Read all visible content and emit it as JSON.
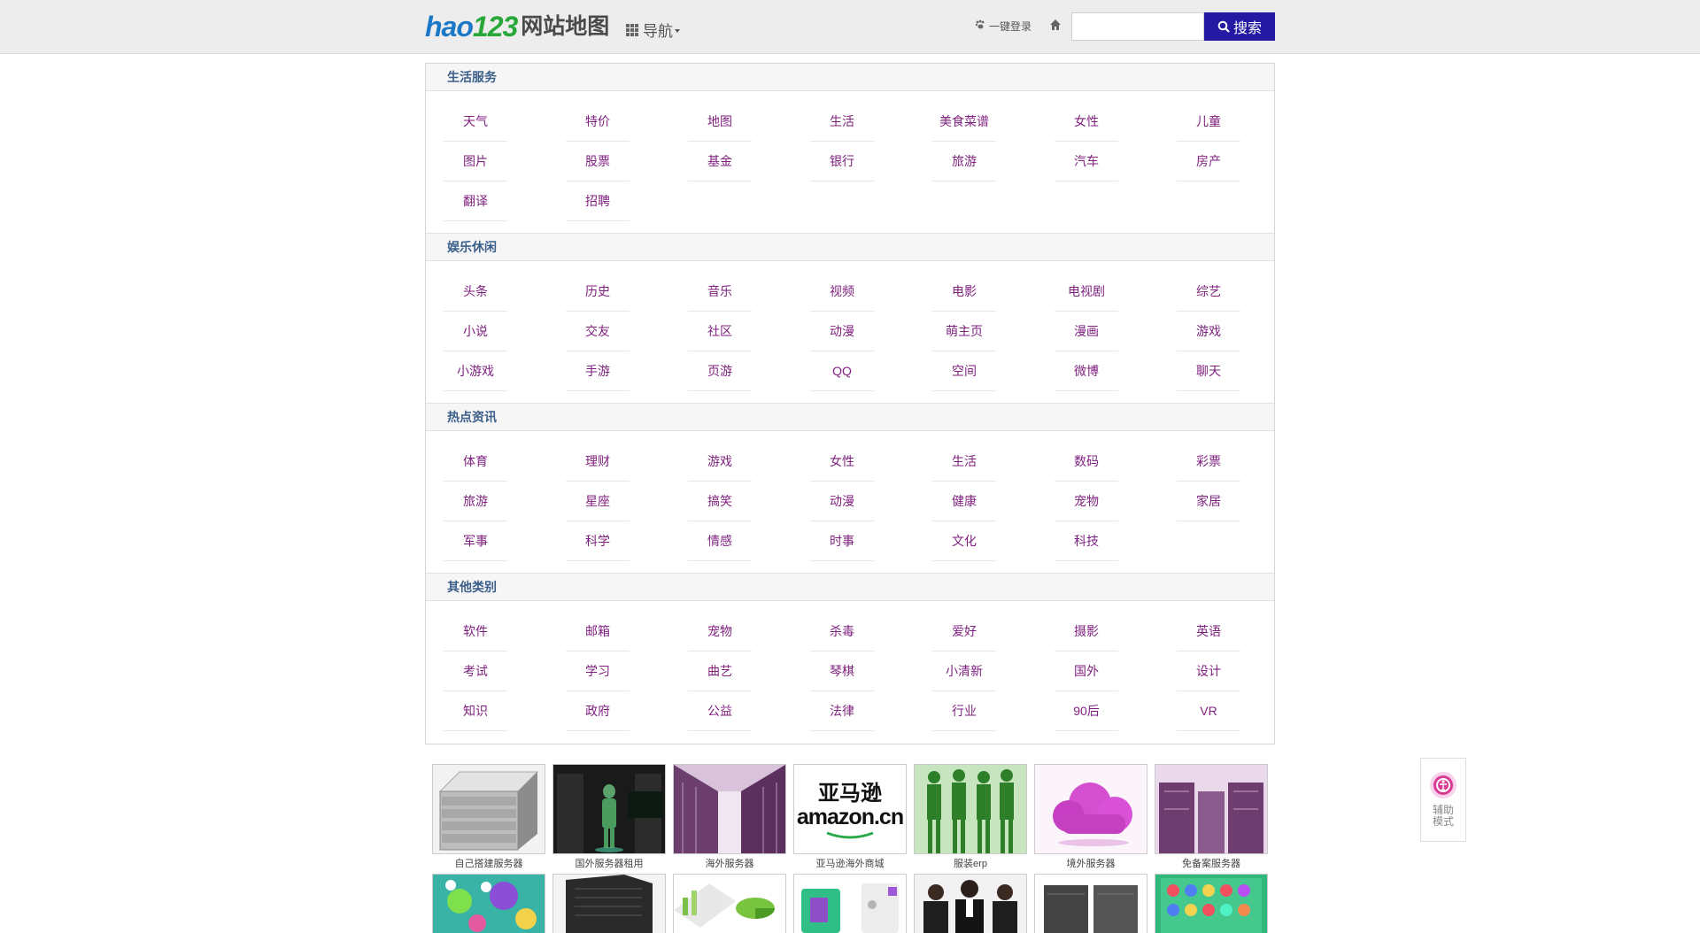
{
  "header": {
    "logo_hao": "hao",
    "logo_123": "123",
    "site_title": "网站地图",
    "nav_label": "导航",
    "login_label": "一键登录",
    "search_placeholder": "",
    "search_button": "搜索"
  },
  "sections": [
    {
      "title": "生活服务",
      "links": [
        "天气",
        "特价",
        "地图",
        "生活",
        "美食菜谱",
        "女性",
        "儿童",
        "图片",
        "股票",
        "基金",
        "银行",
        "旅游",
        "汽车",
        "房产",
        "翻译",
        "招聘"
      ]
    },
    {
      "title": "娱乐休闲",
      "links": [
        "头条",
        "历史",
        "音乐",
        "视频",
        "电影",
        "电视剧",
        "综艺",
        "小说",
        "交友",
        "社区",
        "动漫",
        "萌主页",
        "漫画",
        "游戏",
        "小游戏",
        "手游",
        "页游",
        "QQ",
        "空间",
        "微博",
        "聊天"
      ]
    },
    {
      "title": "热点资讯",
      "links": [
        "体育",
        "理财",
        "游戏",
        "女性",
        "生活",
        "数码",
        "彩票",
        "旅游",
        "星座",
        "搞笑",
        "动漫",
        "健康",
        "宠物",
        "家居",
        "军事",
        "科学",
        "情感",
        "时事",
        "文化",
        "科技"
      ]
    },
    {
      "title": "其他类别",
      "links": [
        "软件",
        "邮箱",
        "宠物",
        "杀毒",
        "爱好",
        "摄影",
        "英语",
        "考试",
        "学习",
        "曲艺",
        "琴棋",
        "小清新",
        "国外",
        "设计",
        "知识",
        "政府",
        "公益",
        "法律",
        "行业",
        "90后",
        "VR"
      ]
    }
  ],
  "thumbnails_row1": [
    {
      "caption": "自己搭建服务器",
      "icon": "server-rack-image"
    },
    {
      "caption": "国外服务器租用",
      "icon": "datacenter-figure-image"
    },
    {
      "caption": "海外服务器",
      "icon": "server-aisle-image"
    },
    {
      "caption": "亚马逊海外商城",
      "icon": "amazon-logo-image",
      "logo_cn": "亚马逊",
      "logo_en": "amazon.cn"
    },
    {
      "caption": "服装erp",
      "icon": "fashion-models-image"
    },
    {
      "caption": "境外服务器",
      "icon": "cloud-image"
    },
    {
      "caption": "免备案服务器",
      "icon": "server-room-image"
    }
  ],
  "thumbnails_row2": [
    {
      "icon": "game-map-image"
    },
    {
      "icon": "server-cabinet-image"
    },
    {
      "icon": "charts-image"
    },
    {
      "icon": "phone-app-image"
    },
    {
      "icon": "business-people-image"
    },
    {
      "icon": "server-tower-image"
    },
    {
      "icon": "match-game-image"
    }
  ],
  "assist": {
    "label": "辅助模式",
    "icon": "accessibility-icon"
  },
  "colors": {
    "link": "#7e1f7e",
    "section_title": "#3b5f8a",
    "search_button": "#2319a2",
    "header_bg": "#ededed"
  }
}
